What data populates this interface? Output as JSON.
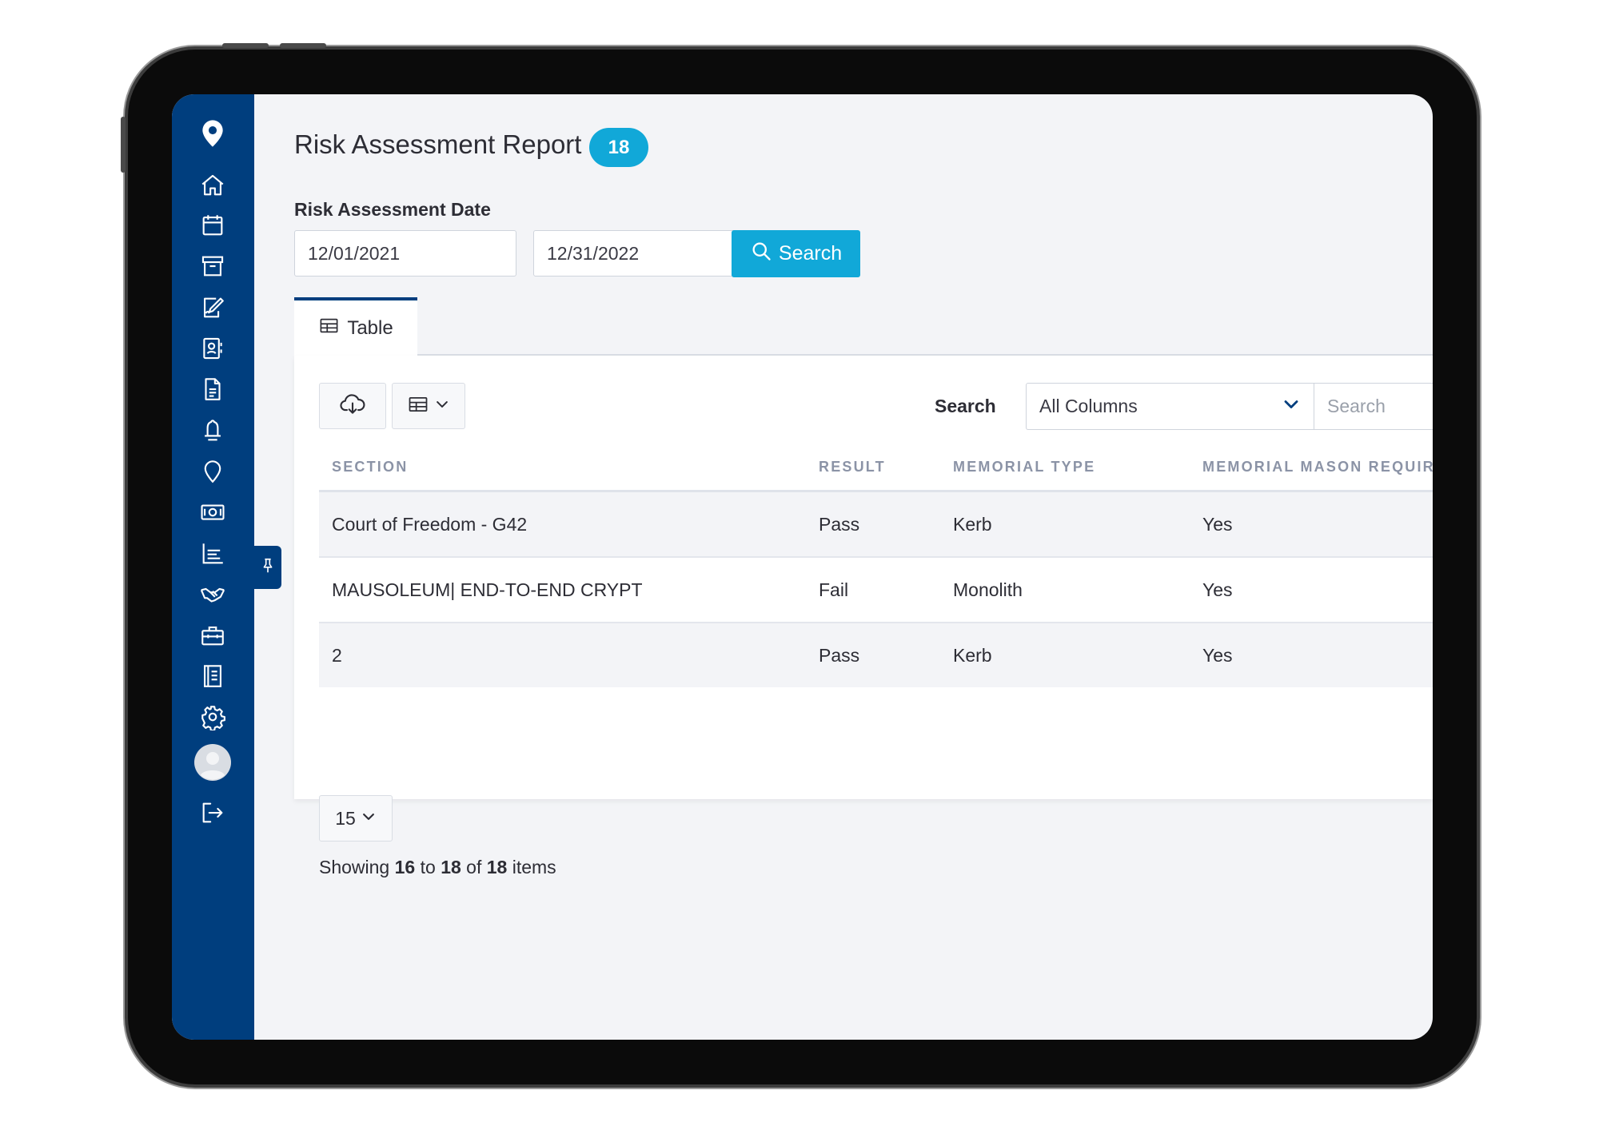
{
  "sidebar": {
    "logo_icon": "map-pin-logo-icon",
    "items": [
      {
        "name": "home",
        "icon": "home-icon"
      },
      {
        "name": "calendar",
        "icon": "calendar-icon"
      },
      {
        "name": "archive",
        "icon": "archive-icon"
      },
      {
        "name": "sign",
        "icon": "signature-icon"
      },
      {
        "name": "contacts",
        "icon": "contact-card-icon"
      },
      {
        "name": "documents",
        "icon": "document-icon"
      },
      {
        "name": "alerts",
        "icon": "bell-icon"
      },
      {
        "name": "locations",
        "icon": "location-pin-icon"
      },
      {
        "name": "payments",
        "icon": "money-icon"
      },
      {
        "name": "reports",
        "icon": "bar-chart-icon"
      },
      {
        "name": "partners",
        "icon": "handshake-icon"
      },
      {
        "name": "tools",
        "icon": "toolbox-icon"
      },
      {
        "name": "records",
        "icon": "ledger-book-icon"
      },
      {
        "name": "settings",
        "icon": "gear-icon"
      }
    ],
    "avatar_icon": "user-avatar-icon",
    "logout_icon": "logout-icon",
    "pin_icon": "pin-icon"
  },
  "header": {
    "title": "Risk Assessment Report",
    "count": "18"
  },
  "date_filter": {
    "label": "Risk Assessment Date",
    "from": "12/01/2021",
    "to": "12/31/2022",
    "search_label": "Search"
  },
  "tabs": [
    {
      "label": "Table",
      "icon": "table-icon",
      "active": true
    }
  ],
  "toolbar": {
    "download_icon": "cloud-download-icon",
    "columns_icon": "table-columns-icon",
    "filter_label": "Search",
    "column_select": "All Columns",
    "search_placeholder": "Search"
  },
  "table": {
    "columns": [
      "SECTION",
      "RESULT",
      "MEMORIAL TYPE",
      "MEMORIAL MASON REQUIRE"
    ],
    "rows": [
      [
        "Court of Freedom - G42",
        "Pass",
        "Kerb",
        "Yes"
      ],
      [
        "MAUSOLEUM| END-TO-END CRYPT",
        "Fail",
        "Monolith",
        "Yes"
      ],
      [
        "2",
        "Pass",
        "Kerb",
        "Yes"
      ]
    ]
  },
  "pagination": {
    "page_size": "15",
    "showing_prefix": "Showing",
    "from": "16",
    "to_word": "to",
    "to": "18",
    "of_word": "of",
    "total": "18",
    "suffix": "items"
  },
  "colors": {
    "sidebar": "#003e7e",
    "accent": "#11a8d8",
    "background": "#f3f4f7"
  }
}
